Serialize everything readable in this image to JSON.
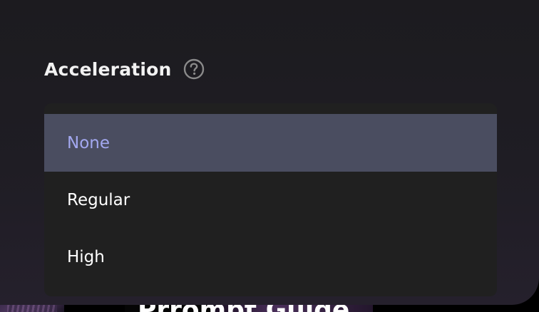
{
  "field": {
    "label": "Acceleration",
    "help_icon": "question-circle-icon"
  },
  "dropdown": {
    "selected": "None",
    "options": [
      {
        "label": "None",
        "selected": true
      },
      {
        "label": "Regular",
        "selected": false
      },
      {
        "label": "High",
        "selected": false
      }
    ]
  },
  "background": {
    "card_title": "Prrompt Guide"
  },
  "colors": {
    "panel_bg": "#1c1b1f",
    "menu_bg": "#202020",
    "selected_bg": "#4a4d60",
    "selected_text": "#a3a8f0",
    "text": "#ffffff"
  }
}
